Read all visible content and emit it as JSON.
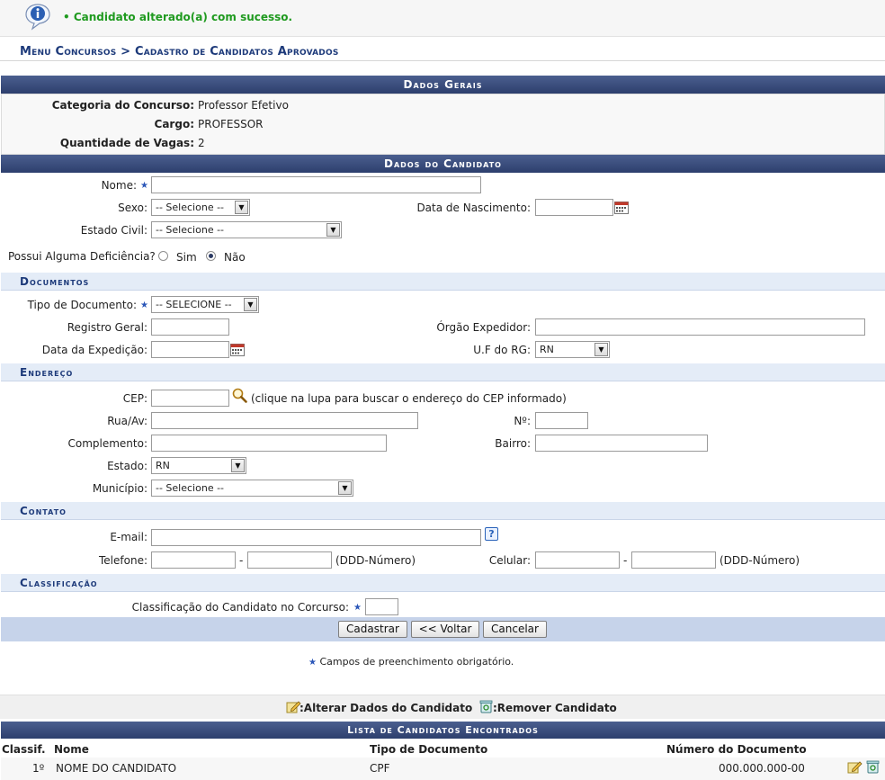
{
  "message": {
    "bullet": "•",
    "text": "Candidato alterado(a) com sucesso."
  },
  "breadcrumb": "Menu Concursos > Cadastro de Candidatos Aprovados",
  "dados_gerais": {
    "title": "Dados Gerais",
    "categoria_label": "Categoria do Concurso:",
    "categoria_value": "Professor Efetivo",
    "cargo_label": "Cargo:",
    "cargo_value": "PROFESSOR",
    "vagas_label": "Quantidade de Vagas:",
    "vagas_value": "2"
  },
  "dados_candidato": {
    "title": "Dados do Candidato",
    "nome_label": "Nome:",
    "sexo_label": "Sexo:",
    "sexo_value": "-- Selecione --",
    "nascimento_label": "Data de Nascimento:",
    "estado_civil_label": "Estado Civil:",
    "estado_civil_value": "-- Selecione --",
    "deficiencia_label": "Possui Alguma Deficiência?",
    "sim": "Sim",
    "nao": "Não",
    "deficiencia_selected": "Não"
  },
  "documentos": {
    "title": "Documentos",
    "tipo_label": "Tipo de Documento:",
    "tipo_value": "-- SELECIONE --",
    "rg_label": "Registro Geral:",
    "orgao_label": "Órgão Expedidor:",
    "data_exp_label": "Data da Expedição:",
    "uf_label": "U.F do RG:",
    "uf_value": "RN"
  },
  "endereco": {
    "title": "Endereço",
    "cep_label": "CEP:",
    "cep_hint": "(clique na lupa para buscar o endereço do CEP informado)",
    "rua_label": "Rua/Av:",
    "numero_label": "Nº:",
    "complemento_label": "Complemento:",
    "bairro_label": "Bairro:",
    "estado_label": "Estado:",
    "estado_value": "RN",
    "municipio_label": "Município:",
    "municipio_value": "-- Selecione --"
  },
  "contato": {
    "title": "Contato",
    "email_label": "E-mail:",
    "help": "?",
    "telefone_label": "Telefone:",
    "dash": "-",
    "ddd_hint": "(DDD-Número)",
    "celular_label": "Celular:"
  },
  "classificacao": {
    "title": "Classificação",
    "label": "Classificação do Candidato no Corcurso:"
  },
  "buttons": {
    "cadastrar": "Cadastrar",
    "voltar": "<< Voltar",
    "cancelar": "Cancelar"
  },
  "required_note": "Campos de preenchimento obrigatório.",
  "legend": {
    "alterar": ":Alterar Dados do Candidato",
    "remover": ":Remover Candidato"
  },
  "lista": {
    "title": "Lista de Candidatos Encontrados",
    "headers": [
      "Classif.",
      "Nome",
      "Tipo de Documento",
      "Número do Documento"
    ],
    "rows": [
      {
        "classif": "1º",
        "nome": "NOME DO CANDIDATO",
        "tipo": "CPF",
        "numero": "000.000.000-00"
      }
    ]
  },
  "colors": {
    "header_dark": "#2d3f6d",
    "sub_header": "#e4ecf7",
    "title_blue": "#1d3a7a",
    "success_green": "#1f9a1f"
  }
}
